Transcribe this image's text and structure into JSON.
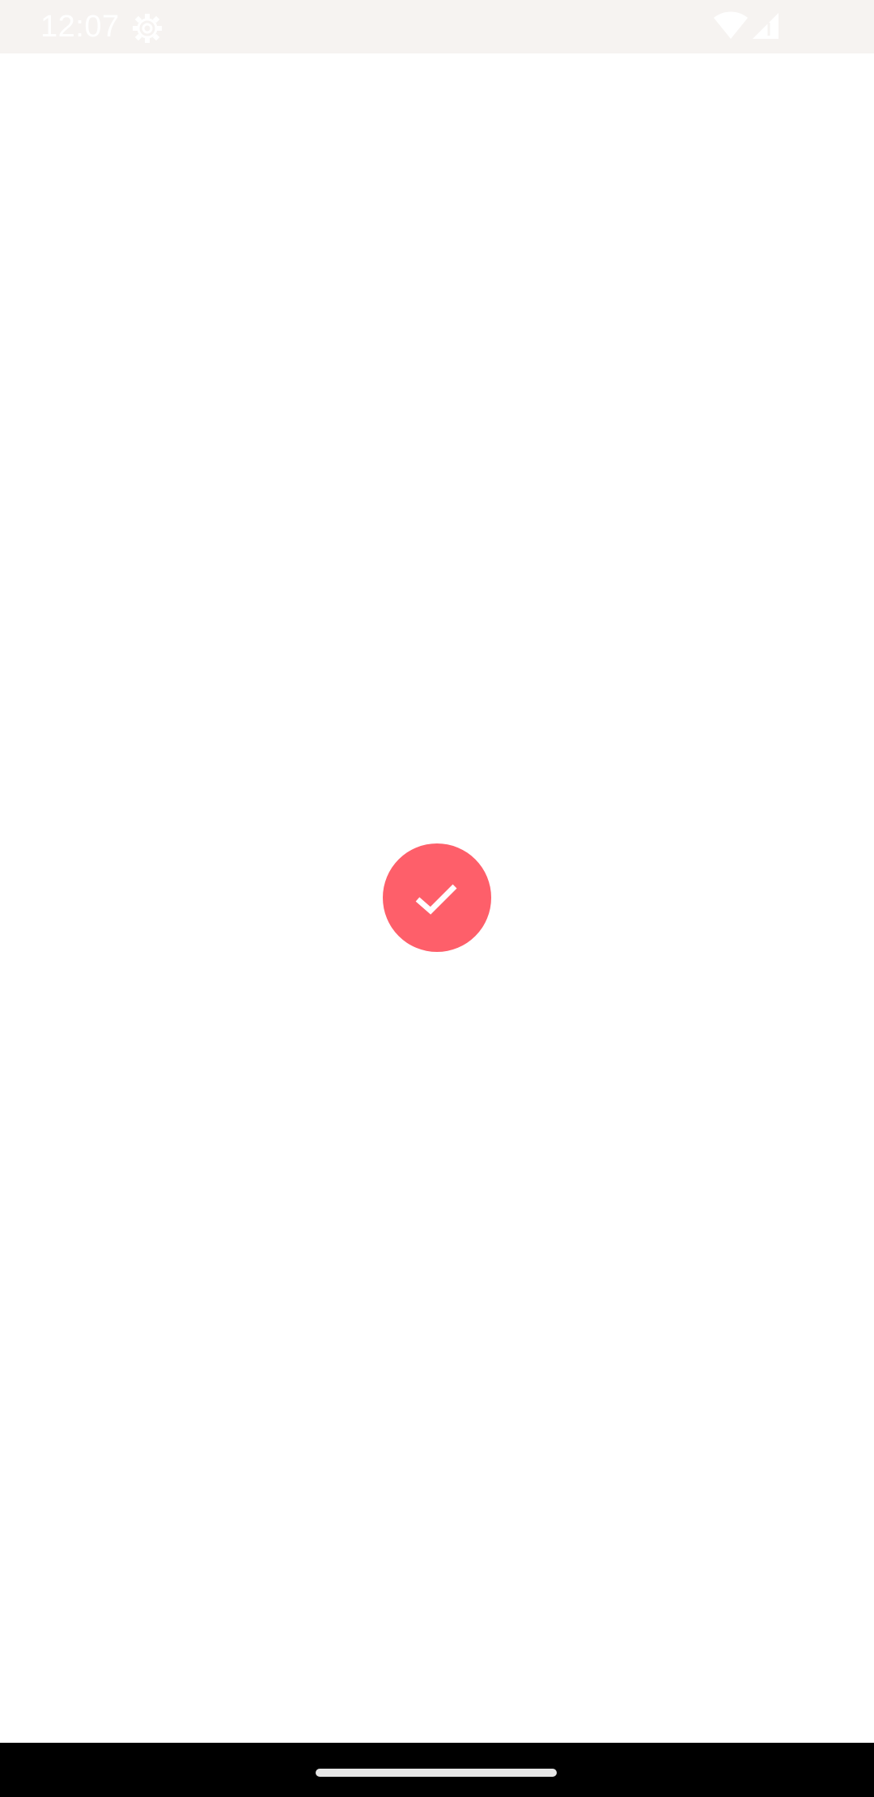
{
  "status_bar": {
    "time": "12:07",
    "icons": [
      "settings-gear-icon",
      "wifi-icon",
      "cellular-signal-icon"
    ]
  },
  "main": {
    "success_icon": "check-icon"
  },
  "nav_bar": {
    "handle": "home-gesture-handle"
  },
  "colors": {
    "status_bar_bg": "#f6f3f1",
    "accent": "#fe5f6a",
    "background": "#ffffff",
    "nav_bar_bg": "#000000"
  }
}
